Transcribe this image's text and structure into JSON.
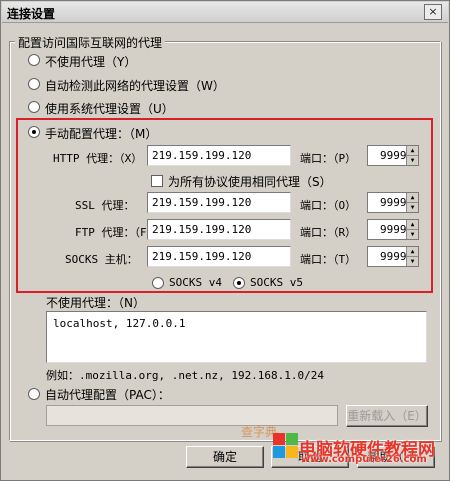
{
  "window": {
    "title": "连接设置",
    "close": "×"
  },
  "group": {
    "label": "配置访问国际互联网的代理"
  },
  "options": {
    "no_proxy": "不使用代理（Y）",
    "auto_detect": "自动检测此网络的代理设置（W）",
    "system_proxy": "使用系统代理设置（U）",
    "manual": "手动配置代理：（M）",
    "selected": "manual"
  },
  "manual": {
    "http": {
      "label": "HTTP 代理：（X）",
      "value": "219.159.199.120",
      "port_label": "端口：（P）",
      "port": "9999"
    },
    "same_proxy": "为所有协议使用相同代理（S）",
    "ssl": {
      "label": "SSL 代理：",
      "value": "219.159.199.120",
      "port_label": "端口：（O）",
      "port": "9999"
    },
    "ftp": {
      "label": "FTP 代理：（F）",
      "value": "219.159.199.120",
      "port_label": "端口：（R）",
      "port": "9999"
    },
    "socks": {
      "label": "SOCKS 主机：",
      "value": "219.159.199.120",
      "port_label": "端口：（T）",
      "port": "9999"
    },
    "socks_v4": "SOCKS v4",
    "socks_v5": "SOCKS v5"
  },
  "no_proxy_for": {
    "label": "不使用代理：（N）",
    "value": "localhost, 127.0.0.1",
    "example": "例如：.mozilla.org, .net.nz, 192.168.1.0/24"
  },
  "pac": {
    "label": "自动代理配置（PAC）：",
    "reload": "重新载入（E）"
  },
  "buttons": {
    "ok": "确定",
    "cancel": "取消",
    "help": "帮助（H）"
  },
  "watermark": {
    "line1": "查字典",
    "line2": "电脑软硬件教程网",
    "line3": "www.computer26.com"
  },
  "colors": {
    "highlight_border": "#d9202a",
    "dialog_bg": "#d4d0c8"
  }
}
